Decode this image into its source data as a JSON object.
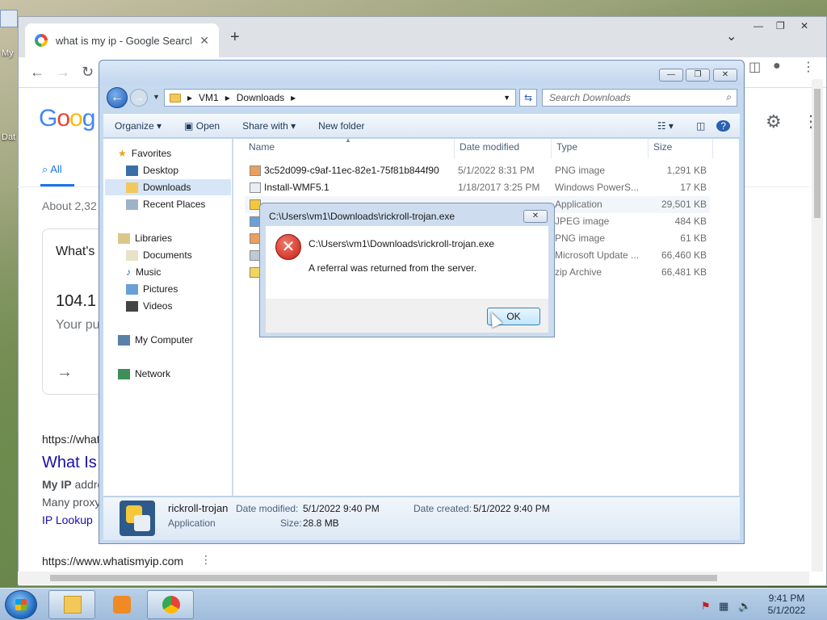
{
  "desktop": {
    "icon_label": "My",
    "icon_label2": "Dat"
  },
  "chrome": {
    "tab_title": "what is my ip - Google Search",
    "tab_close": "✕",
    "new_tab": "+",
    "tab_dropdown": "⌄",
    "window_controls": [
      "—",
      "❐",
      "✕"
    ]
  },
  "google": {
    "logo": [
      "G",
      "o",
      "o",
      "g"
    ],
    "tab_all": "All",
    "about": "About 2,32",
    "card_title": "What's",
    "ip_value": "104.1",
    "your_public": "Your pu",
    "result1_url": "https://what",
    "result1_title": "What Is",
    "snip1_bold": "My IP",
    "snip1_rest": " addre",
    "snip2": "Many proxy",
    "ip_lookup": "IP Lookup",
    "result2_url": "https://www.whatismyip.com",
    "result2_menu": "⋮"
  },
  "explorer": {
    "window_controls": [
      "—",
      "❐",
      "✕"
    ],
    "breadcrumb": [
      "VM1",
      "Downloads"
    ],
    "search_placeholder": "Search Downloads",
    "commands": {
      "organize": "Organize ▾",
      "open": "Open",
      "share": "Share with ▾",
      "new_folder": "New folder"
    },
    "nav": {
      "favorites": "Favorites",
      "desktop": "Desktop",
      "downloads": "Downloads",
      "recent": "Recent Places",
      "libraries": "Libraries",
      "documents": "Documents",
      "music": "Music",
      "pictures": "Pictures",
      "videos": "Videos",
      "computer": "My Computer",
      "network": "Network"
    },
    "columns": {
      "name": "Name",
      "date": "Date modified",
      "type": "Type",
      "size": "Size"
    },
    "files": [
      {
        "name": "3c52d099-c9af-11ec-82e1-75f81b844f90",
        "date": "5/1/2022 8:31 PM",
        "type": "PNG image",
        "size": "1,291 KB",
        "icon": "png-icon"
      },
      {
        "name": "Install-WMF5.1",
        "date": "1/18/2017 3:25 PM",
        "type": "Windows PowerS...",
        "size": "17 KB",
        "icon": "script-icon"
      },
      {
        "name": "",
        "date": "",
        "type": "Application",
        "size": "29,501 KB",
        "icon": "app-icon"
      },
      {
        "name": "",
        "date": "",
        "type": "JPEG image",
        "size": "484 KB",
        "icon": "jpeg-icon"
      },
      {
        "name": "",
        "date": "",
        "type": "PNG image",
        "size": "61 KB",
        "icon": "png-icon"
      },
      {
        "name": "",
        "date": "",
        "type": "Microsoft Update ...",
        "size": "66,460 KB",
        "icon": "msu-icon"
      },
      {
        "name": "",
        "date": "",
        "type": "zip Archive",
        "size": "66,481 KB",
        "icon": "zip-icon"
      }
    ],
    "details": {
      "name": "rickroll-trojan",
      "type": "Application",
      "date_modified_label": "Date modified:",
      "date_modified": "5/1/2022 9:40 PM",
      "date_created_label": "Date created:",
      "date_created": "5/1/2022 9:40 PM",
      "size_label": "Size:",
      "size": "28.8 MB"
    }
  },
  "dialog": {
    "title": "C:\\Users\\vm1\\Downloads\\rickroll-trojan.exe",
    "close": "✕",
    "path": "C:\\Users\\vm1\\Downloads\\rickroll-trojan.exe",
    "message": "A referral was returned from the server.",
    "ok": "OK"
  },
  "taskbar": {
    "time": "9:41 PM",
    "date": "5/1/2022"
  }
}
